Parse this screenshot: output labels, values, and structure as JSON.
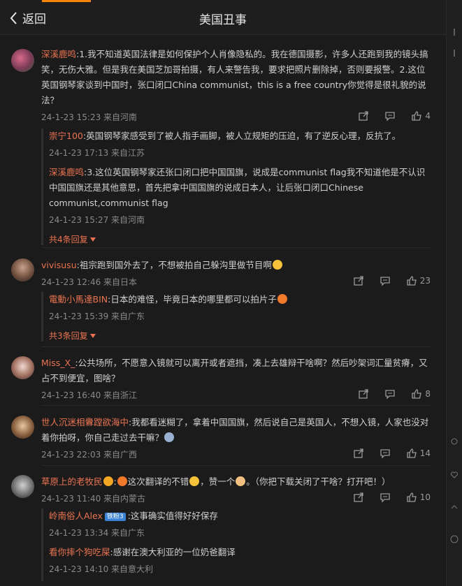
{
  "header": {
    "back_label": "返回",
    "title": "美国丑事"
  },
  "comments": [
    {
      "user": "深溪鹿鸣",
      "text": ":1.我不知道英国法律是如何保护个人肖像隐私的。我在德国摄影，许多人还跑到我的镜头搞笑，无伤大雅。但是我在美国芝加哥拍摄，有人来警告我，要求把照片删除掉，否则要报警。2.这位英国钢琴家谈到中国时，张口闭口China communist，this is a free country你觉得是很礼貌的说法？",
      "meta": "24-1-23 15:23 来自河南",
      "likes": "4",
      "replies": [
        {
          "user": "崇宁100",
          "text": ":英国钢琴家感受到了被人指手画脚，被人立规矩的压迫，有了逆反心理，反抗了。",
          "meta": "24-1-23 17:13 来自江苏"
        },
        {
          "user": "深溪鹿鸣",
          "text": ":3.这位英国钢琴家还张口闭口把中国国旗，说成是communist flag我不知道他是不认识中国国旗还是其他意思，首先把拿中国国旗的说成日本人，让后张口闭口Chinese communist,communist flag",
          "meta": "24-1-23 15:27 来自河南"
        }
      ],
      "more_label": "共4条回复"
    },
    {
      "user": "vivisusu",
      "text": ":祖宗跑到国外去了，不想被拍自己躲沟里做节目啊",
      "meta": "24-1-23 12:46 来自日本",
      "likes": "23",
      "replies": [
        {
          "user": "電動小馬達BIN",
          "text": ":日本的难怪，毕竟日本的哪里都可以拍片子",
          "meta": "24-1-23 15:39 来自广东"
        }
      ],
      "more_label": "共3条回复"
    },
    {
      "user": "Miss_X_",
      "text": ":公共场所，不愿意入镜就可以离开或者遮挡，凑上去雄辩干啥啊？然后吵架词汇量贫瘠，又占不到便宜，图啥？",
      "meta": "24-1-23 16:40 来自浙江",
      "likes": "8"
    },
    {
      "user": "世人沉迷相釁蹚欲海中",
      "text": ":我都看迷糊了，拿着中国国旗，然后说自己是英国人，不想入镜，人家也没对着你拍呀，你自己走过去干嘛？",
      "meta": "24-1-23 22:03 来自广西",
      "likes": "14"
    },
    {
      "user": "草原上的老牧民",
      "text_a": ":",
      "text_b": "这次翻译的不错",
      "text_c": "，赞一个",
      "text_d": "。（你把下载关闭了干啥？打开吧！）",
      "meta": "24-1-23 11:40 来自内蒙古",
      "likes": "10",
      "replies": [
        {
          "user": "岭南俗人Alex",
          "badge": "铁粉3",
          "text": ":这事确实值得好好保存",
          "meta": "24-1-23 13:34 来自广东"
        },
        {
          "user": "看你摔个狗吃屎",
          "text": ":感谢在澳大利亚的一位奶爸翻译",
          "meta": "24-1-23 14:10 来自意大利"
        }
      ]
    }
  ],
  "colors": {
    "username": "#eb7350",
    "accent": "#ff8200",
    "background": "#1b1b1b"
  }
}
